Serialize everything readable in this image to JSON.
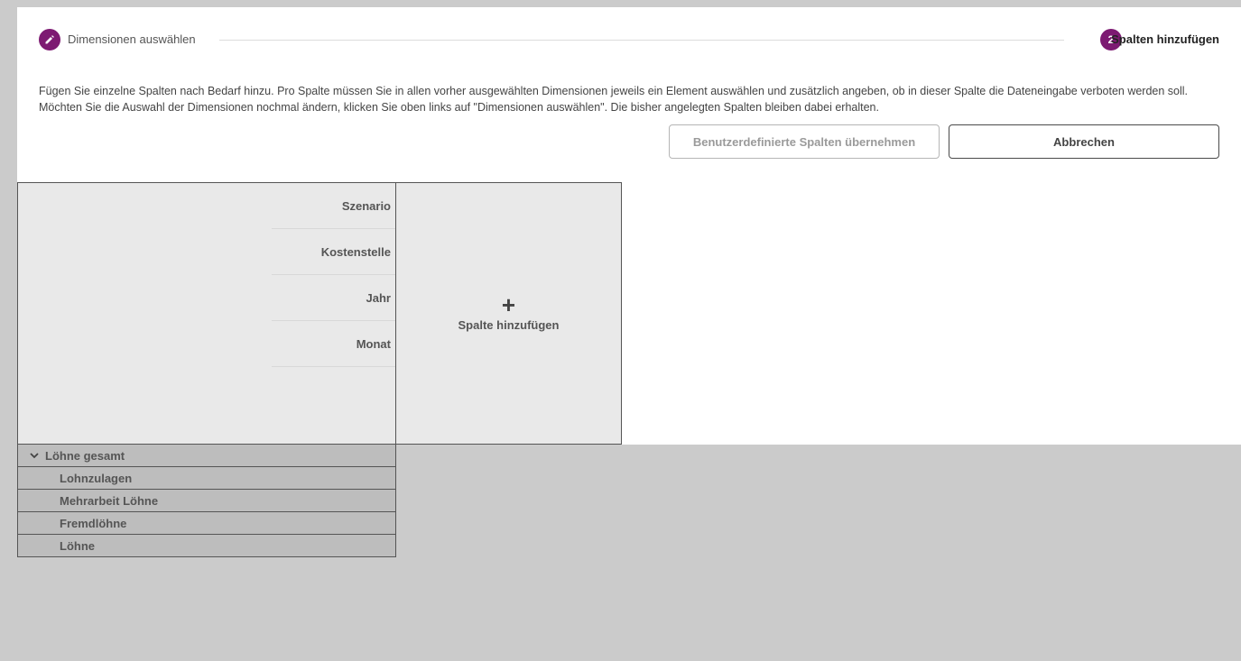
{
  "stepper": {
    "step1": {
      "label": "Dimensionen auswählen",
      "icon": "pencil-icon"
    },
    "step2": {
      "number": "2",
      "label": "Spalten hinzufügen"
    },
    "accent_color": "#7d1a72"
  },
  "description": "Fügen Sie einzelne Spalten nach Bedarf hinzu. Pro Spalte müssen Sie in allen vorher ausgewählten Dimensionen jeweils ein Element auswählen und zusätzlich angeben, ob in dieser Spalte die Dateneingabe verboten werden soll. Möchten Sie die Auswahl der Dimensionen nochmal ändern, klicken Sie oben links auf \"Dimensionen auswählen\". Die bisher angelegten Spalten bleiben dabei erhalten.",
  "buttons": {
    "apply_label": "Benutzerdefinierte Spalten übernehmen",
    "cancel_label": "Abbrechen"
  },
  "dimensions": [
    "Szenario",
    "Kostenstelle",
    "Jahr",
    "Monat"
  ],
  "add_column": {
    "icon": "plus-icon",
    "label": "Spalte hinzufügen"
  },
  "rows": {
    "parent": {
      "label": "Löhne gesamt",
      "icon": "chevron-down-icon"
    },
    "children": [
      "Lohnzulagen",
      "Mehrarbeit Löhne",
      "Fremdlöhne",
      "Löhne"
    ]
  }
}
